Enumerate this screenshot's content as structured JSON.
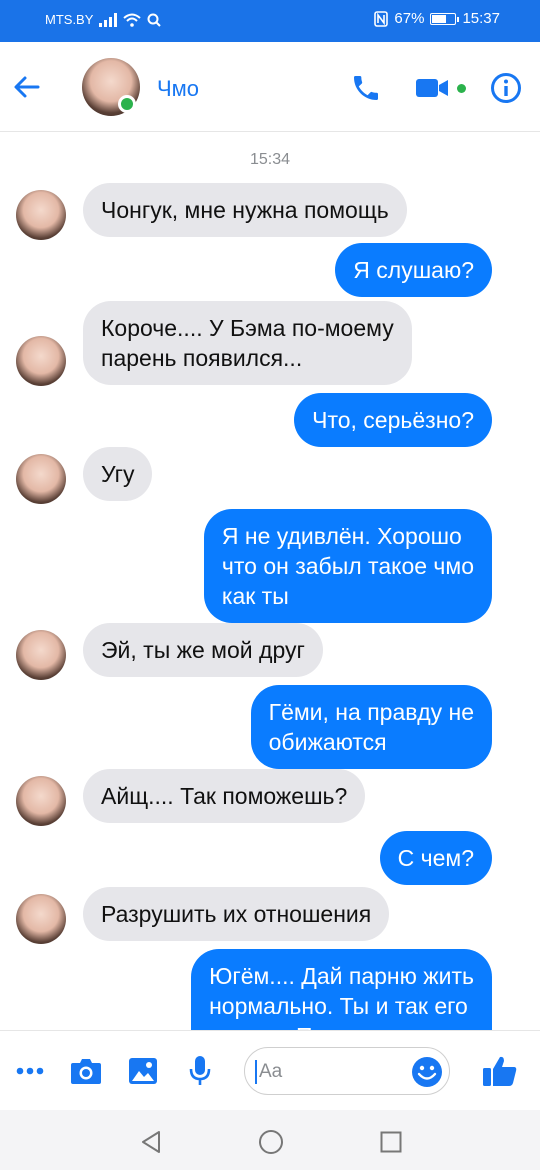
{
  "status_bar": {
    "carrier": "MTS.BY",
    "battery": "67%",
    "battery_level": 0.67,
    "time": "15:37"
  },
  "header": {
    "contact_name": "Чмо",
    "online": true
  },
  "chat": {
    "timestamp": "15:34",
    "messages": [
      {
        "direction": "in",
        "text": "Чонгук, мне нужна помощь"
      },
      {
        "direction": "out",
        "text": "Я слушаю?"
      },
      {
        "direction": "in",
        "text": "Короче.... У Бэма по-моему\nпарень появился..."
      },
      {
        "direction": "out",
        "text": "Что, серьёзно?"
      },
      {
        "direction": "in",
        "text": "Угу"
      },
      {
        "direction": "out",
        "text": "Я не удивлён. Хорошо\nчто он забыл такое чмо\nкак ты"
      },
      {
        "direction": "in",
        "text": "Эй, ты же мой друг"
      },
      {
        "direction": "out",
        "text": "Гёми, на правду не\nобижаются"
      },
      {
        "direction": "in",
        "text": "Айщ.... Так поможешь?"
      },
      {
        "direction": "out",
        "text": "С чем?"
      },
      {
        "direction": "in",
        "text": "Разрушить их отношения"
      },
      {
        "direction": "out",
        "text": "Югём.... Дай парню жить\nнормально. Ты и так его\nдостал. Прекрати"
      }
    ]
  },
  "composer": {
    "placeholder": "Aa"
  },
  "icons": {
    "back": "arrow-left-icon",
    "call": "phone-icon",
    "video": "video-camera-icon",
    "info": "info-icon",
    "more": "more-dots-icon",
    "camera": "camera-icon",
    "gallery": "image-icon",
    "mic": "microphone-icon",
    "emoji": "smiley-icon",
    "like": "thumbs-up-icon"
  },
  "colors": {
    "accent": "#1877f2",
    "outgoing_bubble": "#0a7cff",
    "incoming_bubble": "#e6e6ea",
    "status_bar": "#1a73e8",
    "online": "#2bb24c"
  }
}
